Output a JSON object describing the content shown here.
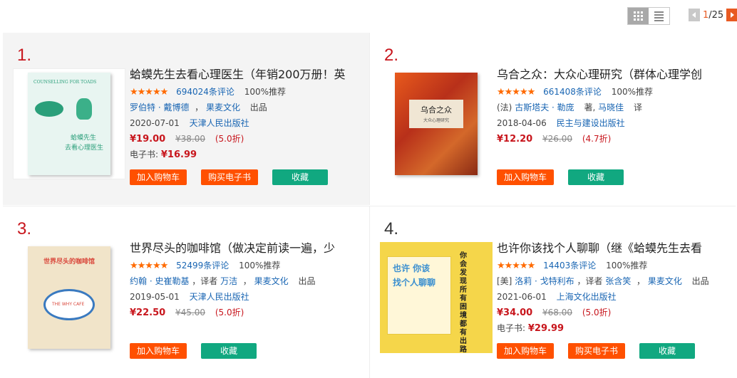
{
  "pagination": {
    "current": "1",
    "total": "/25"
  },
  "books": [
    {
      "rank": "1.",
      "title": "蛤蟆先生去看心理医生（年销200万册！英",
      "stars": "★★★★★",
      "reviews": "694024条评论",
      "recommend": "100%推荐",
      "author": "罗伯特 · 戴博德",
      "publisher_brand": "果麦文化",
      "brand_suffix": "出品",
      "date": "2020-07-01",
      "press": "天津人民出版社",
      "price": "¥19.00",
      "original_price": "¥38.00",
      "discount": "(5.0折)",
      "ebook_label": "电子书:",
      "ebook_price": "¥16.99",
      "buttons": {
        "cart": "加入购物车",
        "ebook": "购买电子书",
        "fav": "收藏"
      },
      "cover": {
        "bg": "#e8f5f1",
        "accent": "#2a9f7a",
        "line1": "蛤蟆先生",
        "line2": "去看心理医生",
        "en": "COUNSELLING FOR TOADS"
      }
    },
    {
      "rank": "2.",
      "title": "乌合之众：大众心理研究（群体心理学创",
      "stars": "★★★★★",
      "reviews": "661408条评论",
      "recommend": "100%推荐",
      "author_prefix": "(法)",
      "author": "古斯塔夫 · 勒庞",
      "author_suffix": "著,",
      "translator": "马晓佳",
      "translator_suffix": "译",
      "date": "2018-04-06",
      "press": "民主与建设出版社",
      "price": "¥12.20",
      "original_price": "¥26.00",
      "discount": "(4.7折)",
      "buttons": {
        "cart": "加入购物车",
        "fav": "收藏"
      },
      "cover": {
        "bg": "#c23a1c",
        "accent": "#e8c090",
        "line1": "乌合之众",
        "line2": "大众心理研究"
      }
    },
    {
      "rank": "3.",
      "title": "世界尽头的咖啡馆（做决定前读一遍，少",
      "stars": "★★★★★",
      "reviews": "52499条评论",
      "recommend": "100%推荐",
      "author": "约翰 · 史崔勒基",
      "translator_prefix": "，译者",
      "translator": "万洁",
      "publisher_brand": "果麦文化",
      "brand_suffix": "出品",
      "date": "2019-05-01",
      "press": "天津人民出版社",
      "price": "¥22.50",
      "original_price": "¥45.00",
      "discount": "(5.0折)",
      "buttons": {
        "cart": "加入购物车",
        "fav": "收藏"
      },
      "cover": {
        "bg": "#f1e4c9",
        "accent": "#d9463a",
        "line1": "世界尽头的咖啡馆",
        "line2": "THE WHY CAFE"
      }
    },
    {
      "rank": "4.",
      "title": "也许你该找个人聊聊（继《蛤蟆先生去看",
      "stars": "★★★★★",
      "reviews": "14403条评论",
      "recommend": "100%推荐",
      "author_prefix": "[美]",
      "author": "洛莉 · 戈特利布",
      "translator_prefix": "，译者",
      "translator": "张含笑",
      "publisher_brand": "果麦文化",
      "brand_suffix": "出品",
      "date": "2021-06-01",
      "press": "上海文化出版社",
      "price": "¥34.00",
      "original_price": "¥68.00",
      "discount": "(5.0折)",
      "ebook_label": "电子书:",
      "ebook_price": "¥29.99",
      "buttons": {
        "cart": "加入购物车",
        "ebook": "购买电子书",
        "fav": "收藏"
      },
      "cover": {
        "bg": "#f5d64a",
        "accent": "#3a8fd0",
        "line1": "也许 你该",
        "line2": "找个人聊聊",
        "side": "你会发现所有困境都有出路"
      }
    }
  ]
}
